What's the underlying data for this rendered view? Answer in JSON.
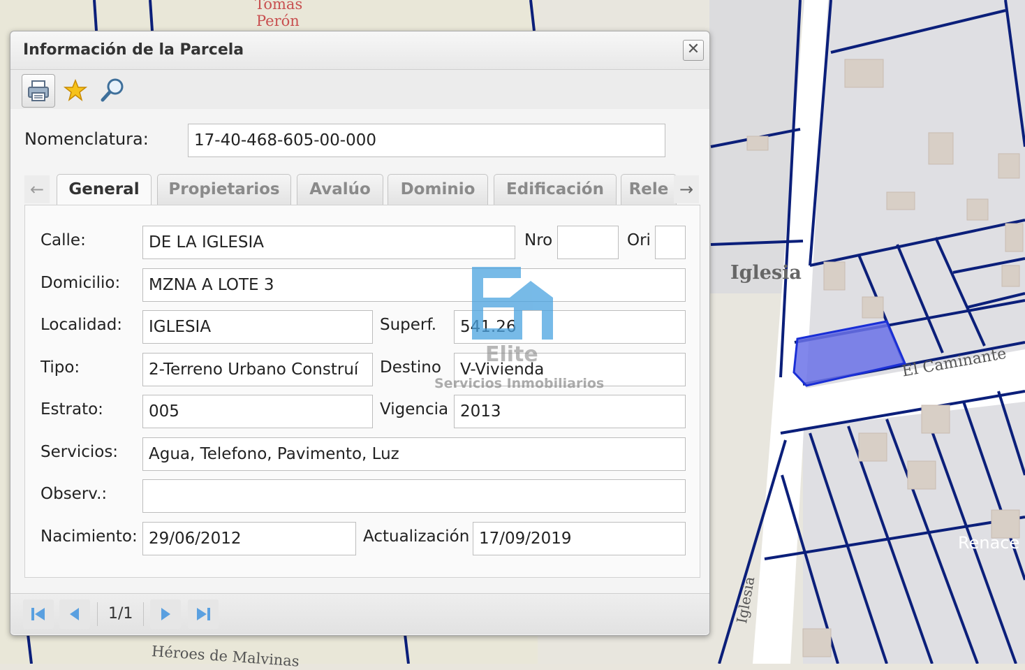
{
  "map": {
    "labels": {
      "top_street_1": "Tomás",
      "top_street_2": "Perón",
      "town": "Iglesia",
      "street_right": "El Caminante",
      "street_vertical": "Iglesia",
      "bottom_street": "Héroes de Malvinas",
      "right_edge": "Renace"
    }
  },
  "dialog": {
    "title": "Información de la Parcela",
    "close_symbol": "✕",
    "toolbar": {
      "print": "printer-icon",
      "favorite": "star-icon",
      "zoom": "magnifier-icon"
    },
    "nomenclatura": {
      "label": "Nomenclatura:",
      "value": "17-40-468-605-00-000"
    },
    "tabs": [
      {
        "label": "General",
        "active": true
      },
      {
        "label": "Propietarios",
        "active": false
      },
      {
        "label": "Avalúo",
        "active": false
      },
      {
        "label": "Dominio",
        "active": false
      },
      {
        "label": "Edificación",
        "active": false
      },
      {
        "label": "Rele",
        "active": false
      }
    ],
    "general": {
      "calle_label": "Calle:",
      "calle": "DE LA IGLESIA",
      "nro_label": "Nro",
      "nro": "",
      "ori_label": "Ori",
      "ori": "",
      "domicilio_label": "Domicilio:",
      "domicilio": "MZNA A LOTE 3",
      "localidad_label": "Localidad:",
      "localidad": "IGLESIA",
      "superf_label": "Superf.",
      "superf": "541.26",
      "tipo_label": "Tipo:",
      "tipo": "2-Terreno Urbano Construí",
      "destino_label": "Destino",
      "destino": "V-Vivienda",
      "estrato_label": "Estrato:",
      "estrato": "005",
      "vigencia_label": "Vigencia",
      "vigencia": "2013",
      "servicios_label": "Servicios:",
      "servicios": "Agua, Telefono, Pavimento, Luz",
      "observ_label": "Observ.:",
      "observ": "",
      "nacimiento_label": "Nacimiento:",
      "nacimiento": "29/06/2012",
      "actualizacion_label": "Actualización",
      "actualizacion": "17/09/2019"
    },
    "pager": {
      "info": "1/1"
    },
    "watermark": {
      "name": "Elite",
      "subtitle": "Servicios Inmobiliarios",
      "color": "#4aa3e0"
    }
  }
}
